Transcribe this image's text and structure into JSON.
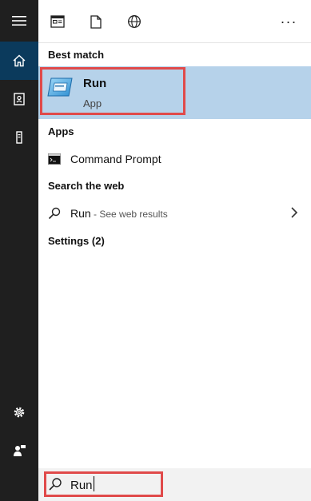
{
  "top_icons": [
    "tiles-icon",
    "document-icon",
    "globe-icon"
  ],
  "more_label": "···",
  "sidebar": {
    "items": [
      {
        "name": "hamburger-menu-icon"
      },
      {
        "name": "home-icon",
        "active": true
      },
      {
        "name": "notebook-icon"
      },
      {
        "name": "tower-icon"
      },
      {
        "name": "gear-icon"
      },
      {
        "name": "feedback-icon"
      }
    ]
  },
  "results": {
    "best_match": {
      "header": "Best match",
      "title": "Run",
      "subtitle": "App",
      "icon": "run-app-icon"
    },
    "apps": {
      "header": "Apps",
      "items": [
        {
          "label": "Command Prompt",
          "icon": "command-prompt-icon"
        }
      ]
    },
    "web": {
      "header": "Search the web",
      "query": "Run",
      "hint": " - See web results",
      "icon": "search-icon"
    },
    "settings": {
      "header": "Settings (2)"
    }
  },
  "search": {
    "value": "Run",
    "icon": "search-icon"
  },
  "colors": {
    "sidebar_bg": "#1f1f1f",
    "active_bg": "#0b3a5c",
    "selected_bg": "#b6d2ea",
    "highlight_border": "#e04a4a"
  }
}
